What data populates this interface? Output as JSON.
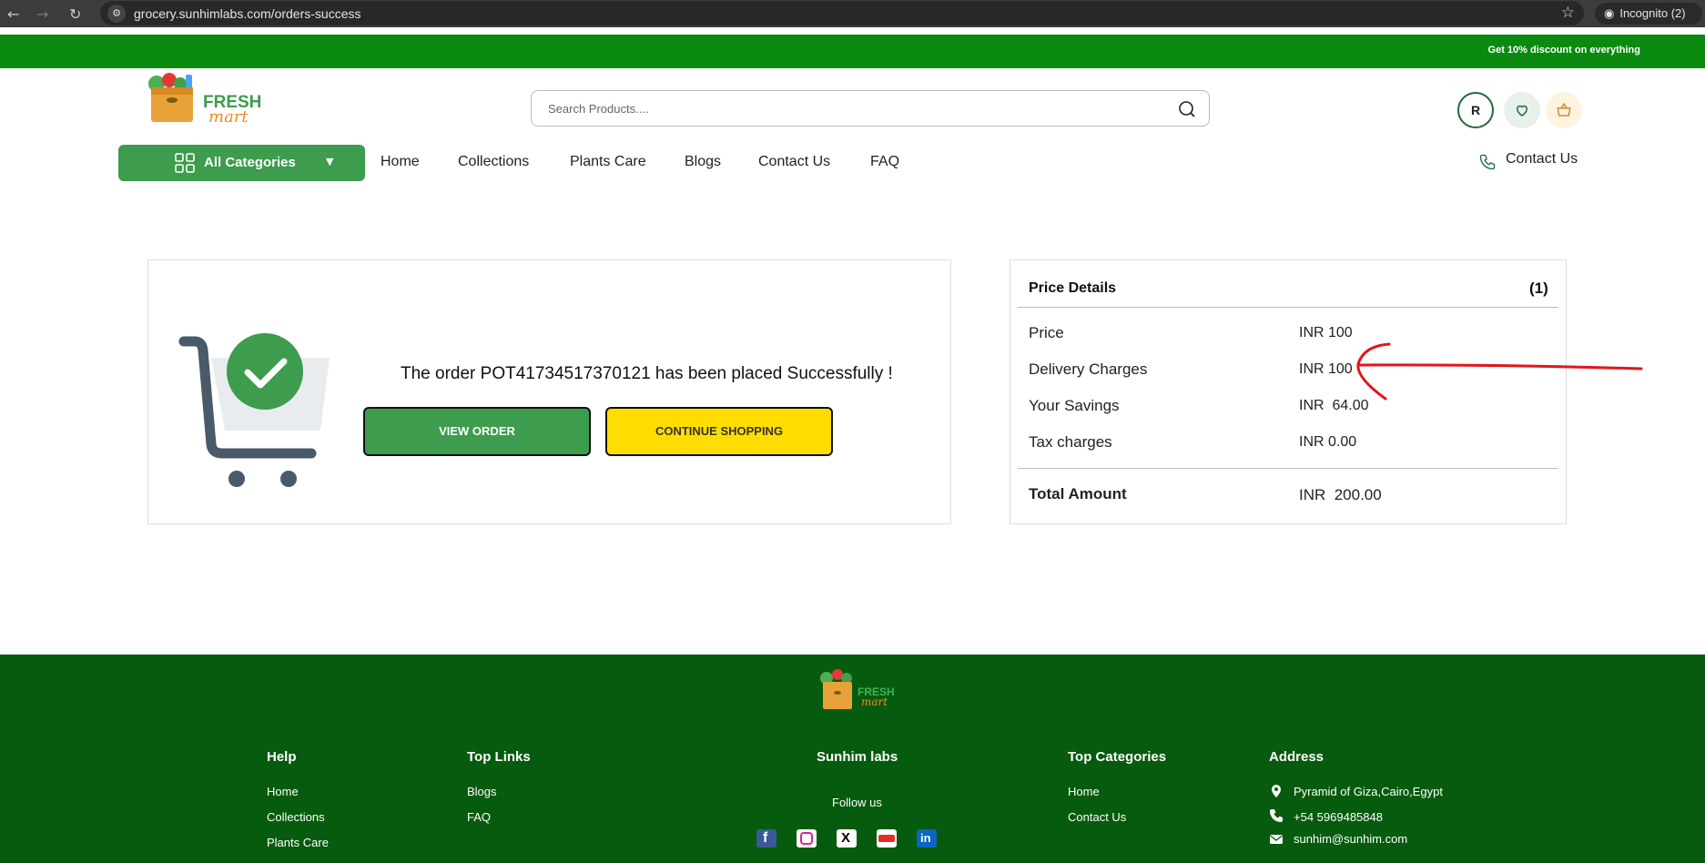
{
  "browser": {
    "url": "grocery.sunhimlabs.com/orders-success",
    "incognito_label": "Incognito (2)"
  },
  "promo": {
    "text": "Get 10% discount on everything"
  },
  "header": {
    "brand_line1": "FRESH",
    "brand_line2": "mart",
    "search_placeholder": "Search Products....",
    "avatar_initial": "R"
  },
  "nav": {
    "categories_label": "All Categories",
    "links": [
      "Home",
      "Collections",
      "Plants Care",
      "Blogs",
      "Contact Us",
      "FAQ"
    ],
    "contact_label": "Contact Us"
  },
  "order": {
    "message": "The order POT41734517370121 has been placed Successfully !",
    "view_button": "VIEW ORDER",
    "continue_button": "CONTINUE SHOPPING"
  },
  "price_details": {
    "title": "Price Details",
    "count": "(1)",
    "rows": [
      {
        "label": "Price",
        "value": "INR 100"
      },
      {
        "label": "Delivery Charges",
        "value": "INR 100"
      },
      {
        "label": "Your Savings",
        "value": "INR  64.00"
      },
      {
        "label": "Tax charges",
        "value": "INR 0.00"
      }
    ],
    "total_label": "Total Amount",
    "total_value": "INR  200.00",
    "annotation_color": "#e3141b"
  },
  "footer": {
    "brand_line1": "FRESH",
    "brand_line2": "mart",
    "help": {
      "title": "Help",
      "links": [
        "Home",
        "Collections",
        "Plants Care"
      ]
    },
    "top_links": {
      "title": "Top Links",
      "links": [
        "Blogs",
        "FAQ"
      ]
    },
    "company": {
      "title": "Sunhim labs",
      "follow_label": "Follow us",
      "social_icons": [
        "facebook-icon",
        "instagram-icon",
        "x-icon",
        "youtube-icon",
        "linkedin-icon"
      ]
    },
    "top_categories": {
      "title": "Top Categories",
      "links": [
        "Home",
        "Contact Us"
      ]
    },
    "address": {
      "title": "Address",
      "location": "Pyramid of Giza,Cairo,Egypt",
      "phone": "+54 5969485848",
      "email": "sunhim@sunhim.com"
    }
  },
  "colors": {
    "primary_green": "#3d9c4d",
    "promo_green": "#0a8a0e",
    "footer_green": "#075b0e",
    "accent_yellow": "#ffdd00"
  }
}
